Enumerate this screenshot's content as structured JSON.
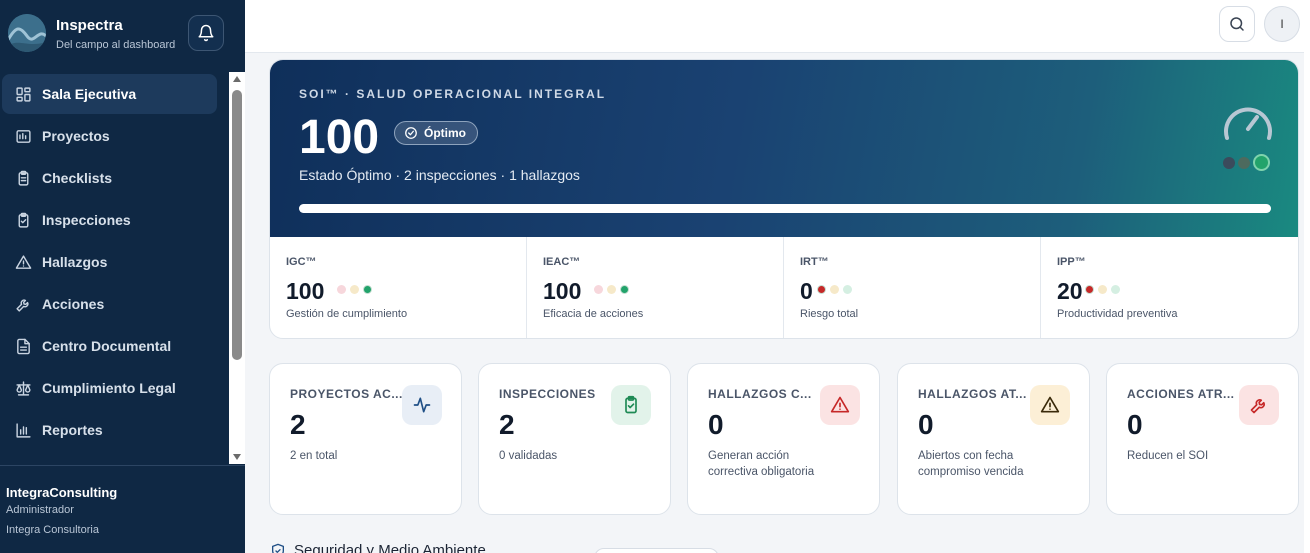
{
  "brand": {
    "title": "Inspectra",
    "subtitle": "Del campo al dashboard"
  },
  "nav": [
    {
      "label": "Sala Ejecutiva",
      "icon": "dashboard-icon",
      "active": true
    },
    {
      "label": "Proyectos",
      "icon": "projects-icon"
    },
    {
      "label": "Checklists",
      "icon": "clipboard-icon"
    },
    {
      "label": "Inspecciones",
      "icon": "clipboard-check-icon"
    },
    {
      "label": "Hallazgos",
      "icon": "warning-icon"
    },
    {
      "label": "Acciones",
      "icon": "wrench-icon"
    },
    {
      "label": "Centro Documental",
      "icon": "document-icon"
    },
    {
      "label": "Cumplimiento Legal",
      "icon": "scale-icon"
    },
    {
      "label": "Reportes",
      "icon": "bar-chart-icon"
    }
  ],
  "org": {
    "name": "IntegraConsulting",
    "role": "Administrador",
    "company": "Integra Consultoria"
  },
  "topbar": {
    "avatar_initial": "I"
  },
  "soi": {
    "label": "SOI™ · SALUD OPERACIONAL INTEGRAL",
    "score": "100",
    "badge": "Óptimo",
    "status": "Estado Óptimo · 2 inspecciones · 1 hallazgos",
    "progress": 1.0
  },
  "metrics": [
    {
      "name": "IGC™",
      "value": "100",
      "desc": "Gestión de cumplimiento",
      "level": "green"
    },
    {
      "name": "IEAC™",
      "value": "100",
      "desc": "Eficacia de acciones",
      "level": "green"
    },
    {
      "name": "IRT™",
      "value": "0",
      "desc": "Riesgo total",
      "level": "red"
    },
    {
      "name": "IPP™",
      "value": "20",
      "desc": "Productividad preventiva",
      "level": "red"
    }
  ],
  "kpis": [
    {
      "title": "PROYECTOS AC...",
      "value": "2",
      "desc": "2 en total",
      "icon": "activity-icon",
      "bg": "#e8eef6",
      "fg": "#1f4f86"
    },
    {
      "title": "INSPECCIONES",
      "value": "2",
      "desc": "0 validadas",
      "icon": "clipboard-check-icon",
      "bg": "#e2f3ea",
      "fg": "#1f8a55"
    },
    {
      "title": "HALLAZGOS C...",
      "value": "0",
      "desc": "Generan acción correctiva obligatoria",
      "icon": "alert-triangle-icon",
      "bg": "#fbe3e3",
      "fg": "#c62828"
    },
    {
      "title": "HALLAZGOS AT...",
      "value": "0",
      "desc": "Abiertos con fecha compromiso vencida",
      "icon": "alert-triangle-icon",
      "bg": "#fcefd6",
      "fg": "#3a2a0a"
    },
    {
      "title": "ACCIONES ATR...",
      "value": "0",
      "desc": "Reducen el SOI",
      "icon": "wrench-icon",
      "bg": "#fbe3e3",
      "fg": "#c62828"
    }
  ],
  "section": {
    "title": "Seguridad y Medio Ambiente"
  }
}
